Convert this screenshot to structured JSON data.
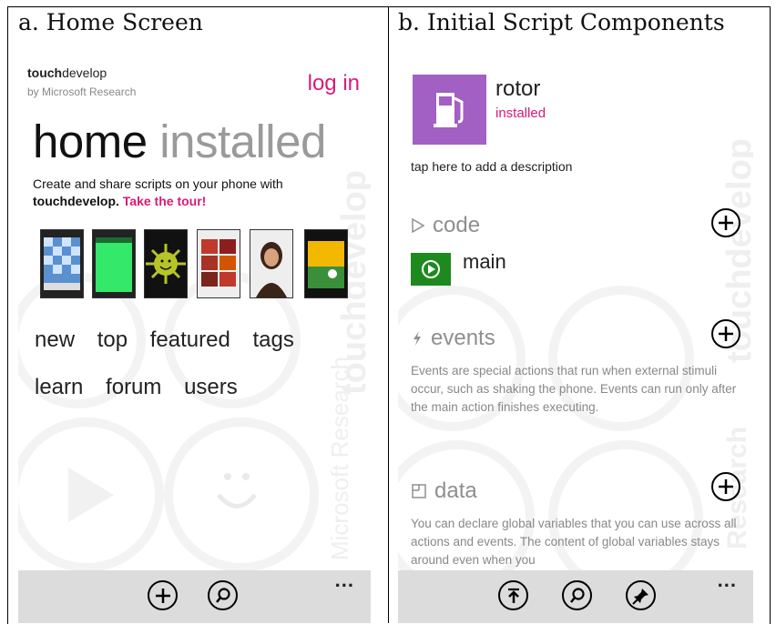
{
  "captions": {
    "left": "a. Home Screen",
    "right": "b. Initial Script Components"
  },
  "home": {
    "brand_bold": "touch",
    "brand_rest": "develop",
    "brand_sub": "by Microsoft Research",
    "login_label": "log in",
    "pivot_home": "home",
    "pivot_installed": "installed",
    "tagline_pre": "Create and share scripts on your phone with",
    "tagline_brand": "touchdevelop",
    "tagline_dot": ". ",
    "tour_link": "Take the tour!",
    "nav_row1": [
      "new",
      "top",
      "featured",
      "tags"
    ],
    "nav_row2": [
      "learn",
      "forum",
      "users"
    ],
    "watermark": "touchdevelop",
    "watermark2": "Microsoft Research",
    "more_label": "..."
  },
  "script": {
    "name": "rotor",
    "status": "installed",
    "description_hint": "tap here to add a description",
    "code_section": "code",
    "main_action": "main",
    "events_section": "events",
    "events_desc": "Events are special actions that run when external stimuli occur, such as shaking the phone. Events can run only after the main action finishes executing.",
    "data_section": "data",
    "data_desc": "You can declare global variables that you can use across all actions and events. The content of global variables stays around even when you",
    "watermark": "touchdevelop",
    "watermark2": "Research",
    "more_label": "..."
  },
  "icons": {
    "add": "plus-circle-icon",
    "search": "search-icon",
    "upload": "upload-icon",
    "pin": "pin-icon",
    "gas_pump": "gas-pump-icon",
    "play": "play-icon"
  },
  "colors": {
    "accent": "#d81b78",
    "tile": "#a25fc4",
    "play_tile": "#1e8a1e",
    "appbar": "#dcdcdc"
  }
}
